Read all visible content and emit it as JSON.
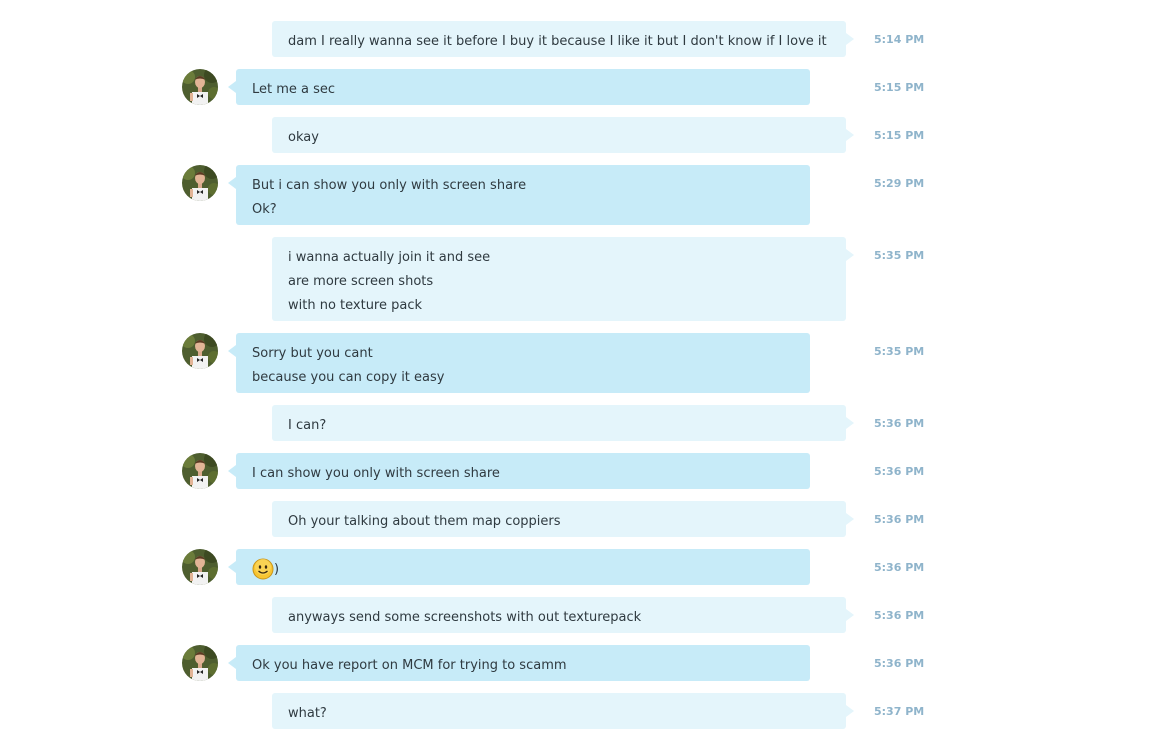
{
  "messages": [
    {
      "sender": "me",
      "lines": [
        "dam I really wanna see it before I buy it because I like it but I don't know if I love it"
      ],
      "time": "5:14 PM"
    },
    {
      "sender": "them",
      "lines": [
        "Let me a sec"
      ],
      "time": "5:15 PM"
    },
    {
      "sender": "me",
      "lines": [
        "okay"
      ],
      "time": "5:15 PM"
    },
    {
      "sender": "them",
      "lines": [
        "But i can show you only with screen share",
        "Ok?"
      ],
      "time": "5:29 PM"
    },
    {
      "sender": "me",
      "lines": [
        "i wanna actually join it and see",
        "are more screen shots",
        "with no texture pack"
      ],
      "time": "5:35 PM"
    },
    {
      "sender": "them",
      "lines": [
        "Sorry but you cant",
        "because you can copy it easy"
      ],
      "time": "5:35 PM"
    },
    {
      "sender": "me",
      "lines": [
        "I can?"
      ],
      "time": "5:36 PM"
    },
    {
      "sender": "them",
      "lines": [
        "I can show you only with screen share"
      ],
      "time": "5:36 PM"
    },
    {
      "sender": "me",
      "lines": [
        "Oh your talking about them map coppiers"
      ],
      "time": "5:36 PM"
    },
    {
      "sender": "them",
      "emoticon": "smile-emoticon",
      "emoticon_suffix": ")",
      "lines": [],
      "time": "5:36 PM"
    },
    {
      "sender": "me",
      "lines": [
        "anyways send some screenshots with out texturepack"
      ],
      "time": "5:36 PM"
    },
    {
      "sender": "them",
      "lines": [
        "Ok you have report on MCM for trying to scamm"
      ],
      "time": "5:36 PM"
    },
    {
      "sender": "me",
      "lines": [
        "what?"
      ],
      "time": "5:37 PM"
    }
  ],
  "colors": {
    "incoming_bubble": "#c7ebf8",
    "outgoing_bubble": "#e4f5fb",
    "timestamp": "#8fb4cb",
    "text": "#2f3a40"
  },
  "icons": {
    "avatar": "contact-avatar",
    "emoticon": "smile-emoticon"
  }
}
